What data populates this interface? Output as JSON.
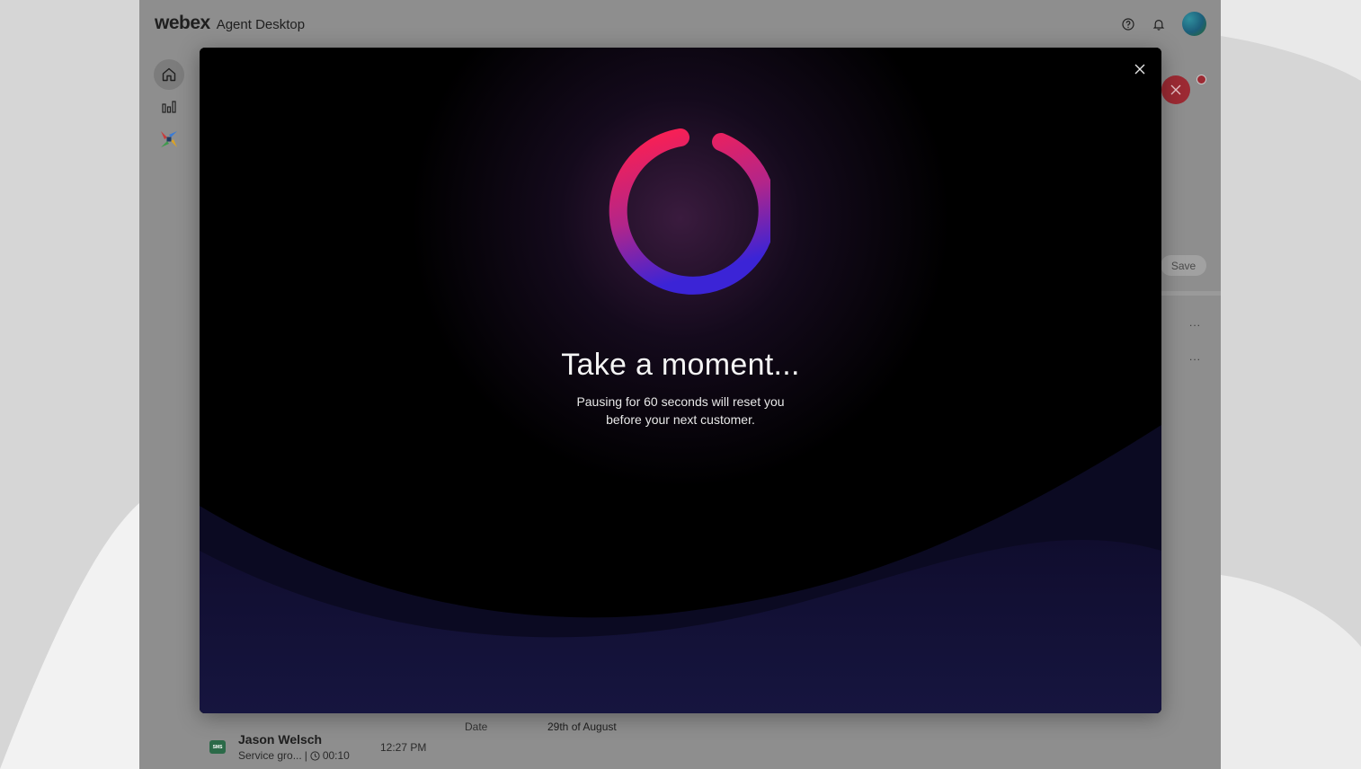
{
  "app": {
    "brand_logo": "webex",
    "brand_product": "Agent Desktop",
    "top_icons": [
      "help-icon",
      "bell-icon"
    ],
    "sidebar_icons": [
      "home-icon",
      "analytics-icon",
      "app-icon"
    ]
  },
  "right_strip": {
    "save_label": "Save",
    "more_1": "...",
    "more_2": "..."
  },
  "contact": {
    "channel_badge": "SMS",
    "name": "Jason Welsch",
    "subtitle": "Service gro...",
    "duration": "00:10",
    "time": "12:27 PM",
    "date_label": "Date",
    "date_value": "29th of August"
  },
  "modal": {
    "title": "Take a moment...",
    "message_line1": "Pausing for 60 seconds will reset you",
    "message_line2": "before your next customer.",
    "colors": {
      "ring_start": "#ff1f4f",
      "ring_end": "#3b24d6",
      "background": "#000000",
      "wave": "#15133a"
    }
  }
}
